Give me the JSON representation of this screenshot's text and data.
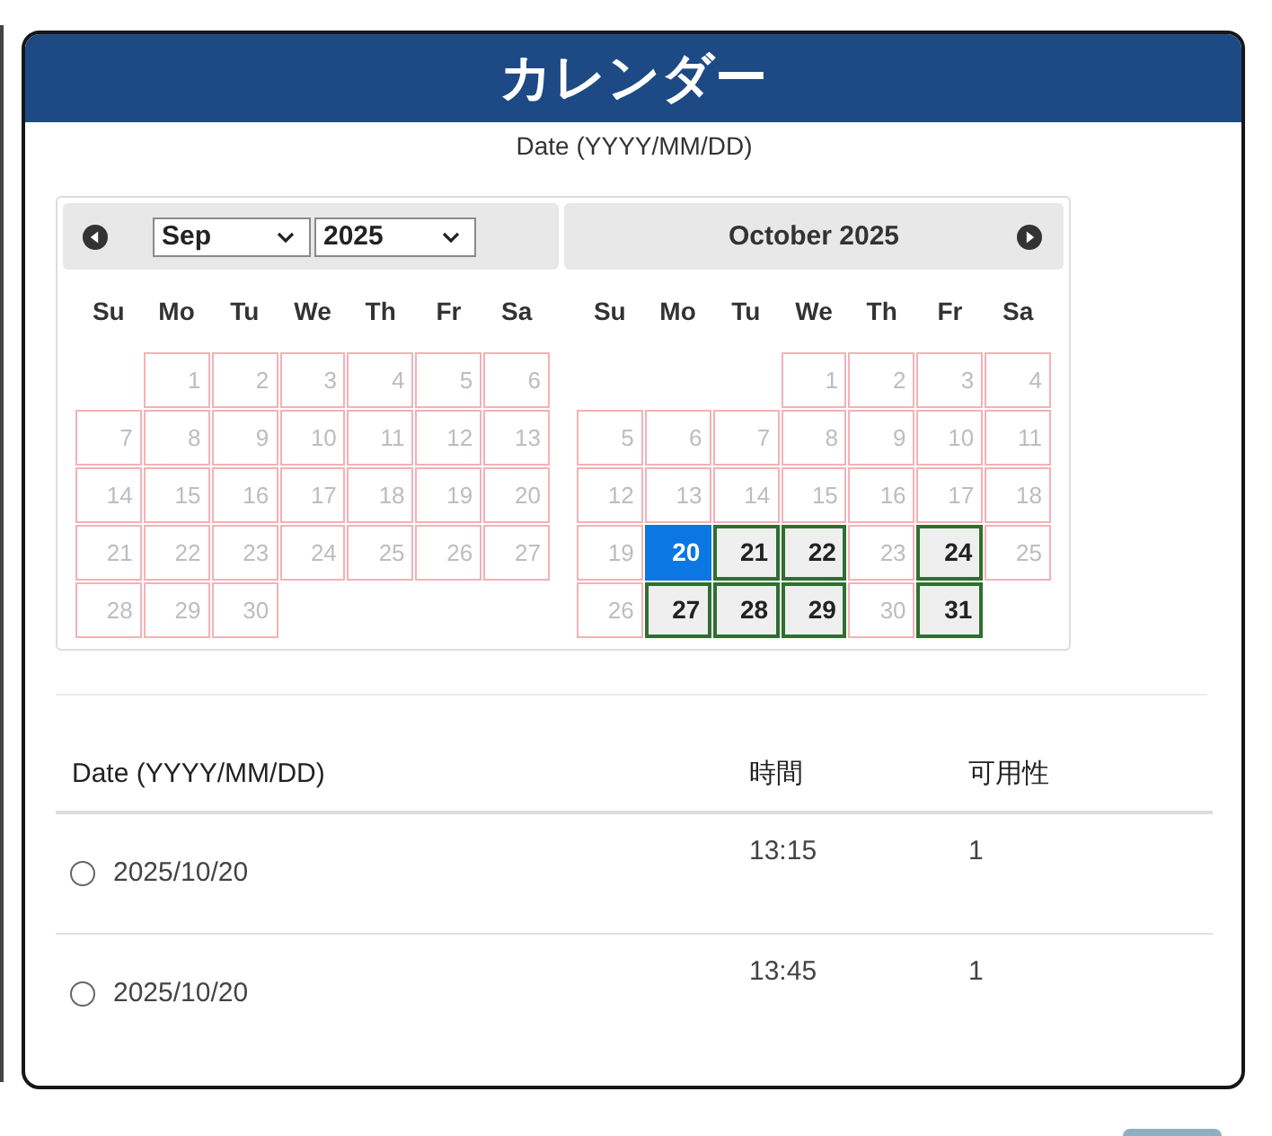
{
  "window": {
    "title": "カレンダー"
  },
  "date_field": {
    "label": "Date (YYYY/MM/DD)"
  },
  "datepicker": {
    "months": [
      {
        "kind": "selects",
        "month_select": "Sep",
        "year_select": "2025",
        "weekdays": [
          "Su",
          "Mo",
          "Tu",
          "We",
          "Th",
          "Fr",
          "Sa"
        ],
        "weeks": [
          {
            "kind": "padded",
            "days": [
              {
                "day": "1",
                "available": false,
                "selected": false
              },
              {
                "day": "2",
                "available": false,
                "selected": false
              },
              {
                "day": "3",
                "available": false,
                "selected": false
              },
              {
                "day": "4",
                "available": false,
                "selected": false
              },
              {
                "day": "5",
                "available": false,
                "selected": false
              },
              {
                "day": "6",
                "available": false,
                "selected": false
              }
            ]
          },
          {
            "kind": "plain",
            "days": [
              {
                "day": "7",
                "available": false,
                "selected": false
              },
              {
                "day": "8",
                "available": false,
                "selected": false
              },
              {
                "day": "9",
                "available": false,
                "selected": false
              },
              {
                "day": "10",
                "available": false,
                "selected": false
              },
              {
                "day": "11",
                "available": false,
                "selected": false
              },
              {
                "day": "12",
                "available": false,
                "selected": false
              },
              {
                "day": "13",
                "available": false,
                "selected": false
              }
            ]
          },
          {
            "kind": "plain",
            "days": [
              {
                "day": "14",
                "available": false,
                "selected": false
              },
              {
                "day": "15",
                "available": false,
                "selected": false
              },
              {
                "day": "16",
                "available": false,
                "selected": false
              },
              {
                "day": "17",
                "available": false,
                "selected": false
              },
              {
                "day": "18",
                "available": false,
                "selected": false
              },
              {
                "day": "19",
                "available": false,
                "selected": false
              },
              {
                "day": "20",
                "available": false,
                "selected": false
              }
            ]
          },
          {
            "kind": "plain",
            "days": [
              {
                "day": "21",
                "available": false,
                "selected": false
              },
              {
                "day": "22",
                "available": false,
                "selected": false
              },
              {
                "day": "23",
                "available": false,
                "selected": false
              },
              {
                "day": "24",
                "available": false,
                "selected": false
              },
              {
                "day": "25",
                "available": false,
                "selected": false
              },
              {
                "day": "26",
                "available": false,
                "selected": false
              },
              {
                "day": "27",
                "available": false,
                "selected": false
              }
            ]
          },
          {
            "kind": "plain",
            "days": [
              {
                "day": "28",
                "available": false,
                "selected": false
              },
              {
                "day": "29",
                "available": false,
                "selected": false
              },
              {
                "day": "30",
                "available": false,
                "selected": false
              }
            ]
          }
        ]
      },
      {
        "kind": "title",
        "title": "October 2025",
        "weekdays": [
          "Su",
          "Mo",
          "Tu",
          "We",
          "Th",
          "Fr",
          "Sa"
        ],
        "weeks": [
          {
            "kind": "padded",
            "days": [
              {
                "day": "1",
                "available": false,
                "selected": false
              },
              {
                "day": "2",
                "available": false,
                "selected": false
              },
              {
                "day": "3",
                "available": false,
                "selected": false
              },
              {
                "day": "4",
                "available": false,
                "selected": false
              }
            ]
          },
          {
            "kind": "plain",
            "days": [
              {
                "day": "5",
                "available": false,
                "selected": false
              },
              {
                "day": "6",
                "available": false,
                "selected": false
              },
              {
                "day": "7",
                "available": false,
                "selected": false
              },
              {
                "day": "8",
                "available": false,
                "selected": false
              },
              {
                "day": "9",
                "available": false,
                "selected": false
              },
              {
                "day": "10",
                "available": false,
                "selected": false
              },
              {
                "day": "11",
                "available": false,
                "selected": false
              }
            ]
          },
          {
            "kind": "plain",
            "days": [
              {
                "day": "12",
                "available": false,
                "selected": false
              },
              {
                "day": "13",
                "available": false,
                "selected": false
              },
              {
                "day": "14",
                "available": false,
                "selected": false
              },
              {
                "day": "15",
                "available": false,
                "selected": false
              },
              {
                "day": "16",
                "available": false,
                "selected": false
              },
              {
                "day": "17",
                "available": false,
                "selected": false
              },
              {
                "day": "18",
                "available": false,
                "selected": false
              }
            ]
          },
          {
            "kind": "plain",
            "days": [
              {
                "day": "19",
                "available": false,
                "selected": false
              },
              {
                "day": "20",
                "available": true,
                "selected": true
              },
              {
                "day": "21",
                "available": true,
                "selected": false
              },
              {
                "day": "22",
                "available": true,
                "selected": false
              },
              {
                "day": "23",
                "available": false,
                "selected": false
              },
              {
                "day": "24",
                "available": true,
                "selected": false
              },
              {
                "day": "25",
                "available": false,
                "selected": false
              }
            ]
          },
          {
            "kind": "plain",
            "days": [
              {
                "day": "26",
                "available": false,
                "selected": false
              },
              {
                "day": "27",
                "available": true,
                "selected": false
              },
              {
                "day": "28",
                "available": true,
                "selected": false
              },
              {
                "day": "29",
                "available": true,
                "selected": false
              },
              {
                "day": "30",
                "available": false,
                "selected": false
              },
              {
                "day": "31",
                "available": true,
                "selected": false
              }
            ]
          }
        ]
      }
    ]
  },
  "table": {
    "columns": [
      "Date (YYYY/MM/DD)",
      "時間",
      "可用性"
    ],
    "rows": [
      {
        "selected": false,
        "date": "2025/10/20",
        "time": "13:15",
        "availability": "1"
      },
      {
        "selected": false,
        "date": "2025/10/20",
        "time": "13:45",
        "availability": "1"
      }
    ]
  }
}
